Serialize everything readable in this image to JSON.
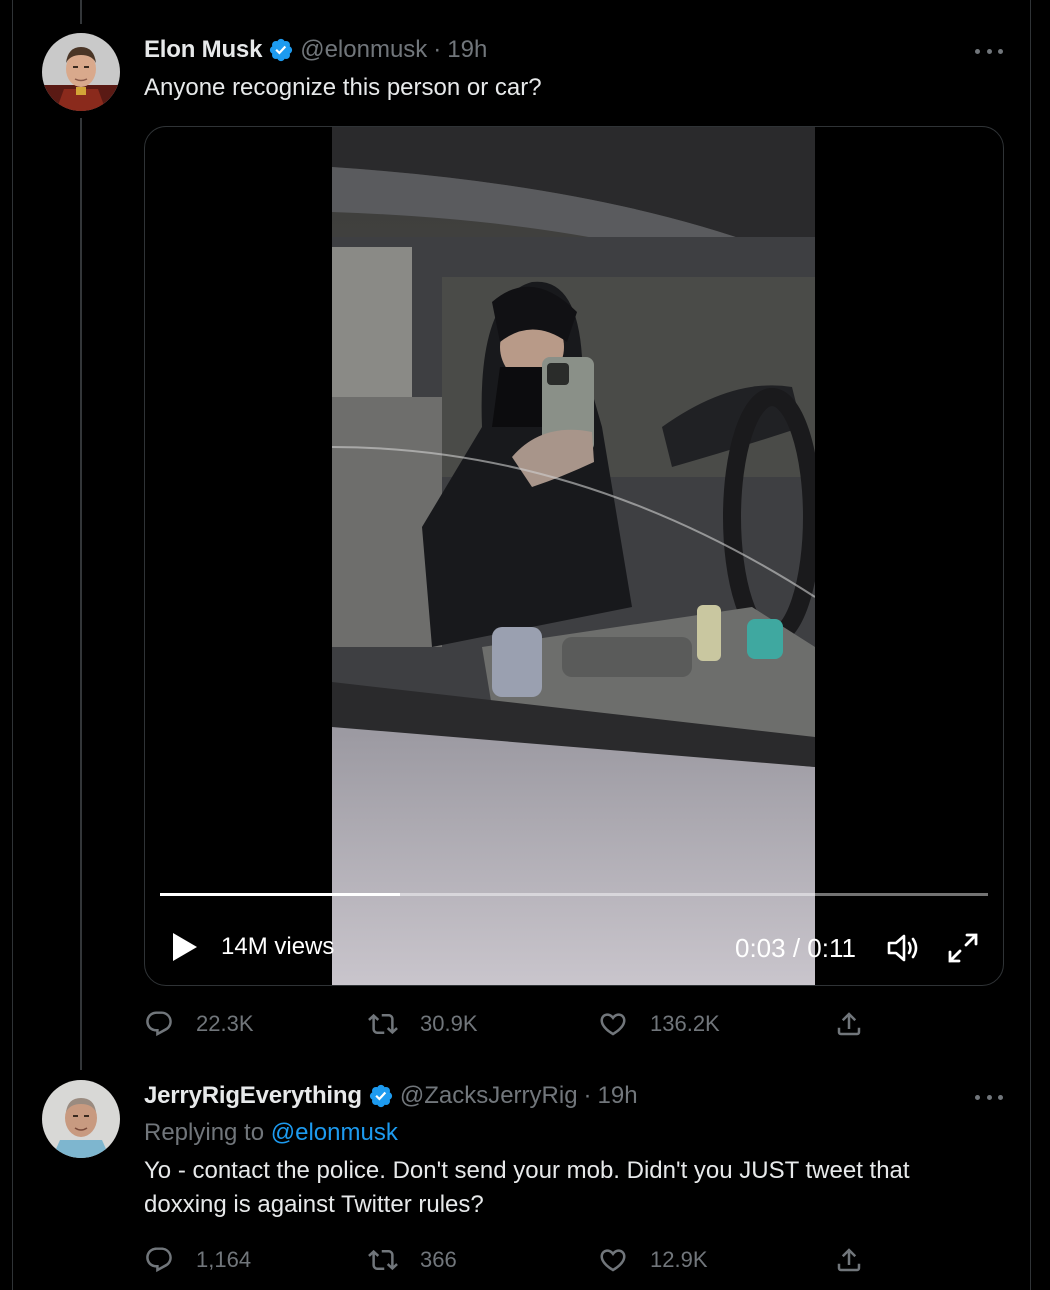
{
  "tweet": {
    "author_name": "Elon Musk",
    "handle": "@elonmusk",
    "separator": "·",
    "time": "19h",
    "text": "Anyone recognize this person or car?",
    "media": {
      "views": "14M views",
      "timecode": "0:03 / 0:11",
      "progress": 0.29
    },
    "stats": {
      "replies": "22.3K",
      "retweets": "30.9K",
      "likes": "136.2K"
    }
  },
  "reply": {
    "author_name": "JerryRigEverything",
    "handle": "@ZacksJerryRig",
    "separator": "·",
    "time": "19h",
    "replying_label": "Replying to",
    "replying_to": "@elonmusk",
    "text_line1": "Yo - contact the police. Don't send your mob. Didn't you JUST tweet that",
    "text_line2": "doxxing is against Twitter rules?",
    "stats": {
      "replies": "1,164",
      "retweets": "366",
      "likes": "12.9K"
    }
  },
  "colors": {
    "background": "#000000",
    "text": "#e7e9ea",
    "muted": "#71767b",
    "link": "#1d9bf0",
    "verified": "#1d9bf0"
  },
  "icons": [
    "verified-badge-icon",
    "more-icon",
    "play-icon",
    "volume-icon",
    "fullscreen-icon",
    "reply-icon",
    "retweet-icon",
    "like-icon",
    "share-icon"
  ]
}
